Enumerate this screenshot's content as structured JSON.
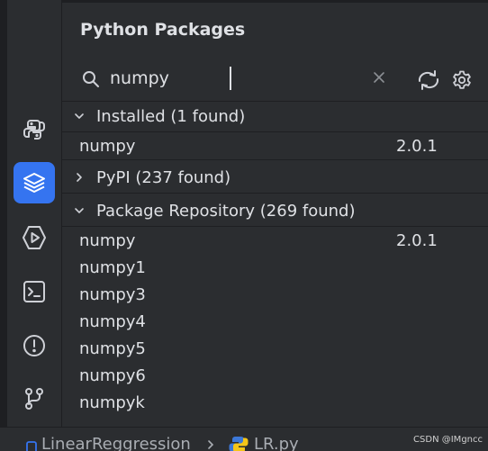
{
  "panel": {
    "title": "Python Packages"
  },
  "search": {
    "value": "numpy"
  },
  "groups": [
    {
      "label": "Installed (1 found)",
      "expanded": true,
      "rows": [
        {
          "name": "numpy",
          "version": "2.0.1"
        }
      ]
    },
    {
      "label": "PyPI (237 found)",
      "expanded": false,
      "rows": []
    },
    {
      "label": "Package Repository (269 found)",
      "expanded": true,
      "rows": [
        {
          "name": "numpy",
          "version": "2.0.1"
        },
        {
          "name": "numpy1",
          "version": ""
        },
        {
          "name": "numpy3",
          "version": ""
        },
        {
          "name": "numpy4",
          "version": ""
        },
        {
          "name": "numpy5",
          "version": ""
        },
        {
          "name": "numpy6",
          "version": ""
        },
        {
          "name": "numpyk",
          "version": ""
        }
      ]
    }
  ],
  "toolbar": {
    "icons": [
      "python-console-icon",
      "python-packages-icon",
      "services-icon",
      "terminal-icon",
      "problems-icon",
      "git-icon"
    ],
    "active": "python-packages-icon",
    "accent": "#3574f0"
  },
  "status_bar": {
    "project": "LinearReggression",
    "file": "LR.py"
  },
  "watermark": "CSDN @IMgncc"
}
